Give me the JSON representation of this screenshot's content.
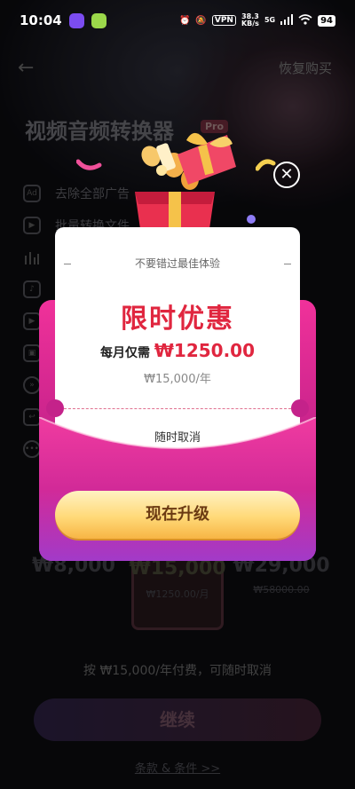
{
  "status_bar": {
    "time": "10:04",
    "vpn": "VPN",
    "speed_value": "38.3",
    "speed_unit": "KB/s",
    "network": "5G",
    "battery": "94"
  },
  "nav": {
    "restore": "恢复购买"
  },
  "app": {
    "title": "视频音频转换器",
    "pro_badge": "Pro",
    "features": [
      {
        "label": "去除全部广告",
        "icon": "ad-icon"
      },
      {
        "label": "批量转换文件",
        "icon": "video-batch-icon"
      },
      {
        "label": "",
        "icon": "audio-bars-icon"
      },
      {
        "label": "",
        "icon": "music-note-icon"
      },
      {
        "label": "",
        "icon": "play-icon"
      },
      {
        "label": "",
        "icon": "image-icon"
      },
      {
        "label": "",
        "icon": "fast-forward-icon"
      },
      {
        "label": "",
        "icon": "reply-icon"
      },
      {
        "label": "",
        "icon": "more-icon"
      }
    ],
    "plans": [
      {
        "price": "₩8,000",
        "sub": ""
      },
      {
        "price": "₩15,000",
        "sub": "₩1250.00/月"
      },
      {
        "price": "₩29,000",
        "sub": "₩58000.00"
      }
    ],
    "pay_note": "按 ₩15,000/年付费，可随时取消",
    "continue": "继续",
    "terms": "条款 & 条件 >>"
  },
  "popup": {
    "tagline": "不要错过最佳体验",
    "headline": "限时优惠",
    "monthly_prefix": "每月仅需",
    "monthly_amount": "₩1250.00",
    "yearly": "₩15,000/年",
    "cancel_anytime": "随时取消",
    "upgrade": "现在升级"
  },
  "colors": {
    "accent_red": "#e0263f",
    "envelope_pink": "#f0319a",
    "envelope_purple": "#a23ac8",
    "button_gold": "#ffd978"
  }
}
